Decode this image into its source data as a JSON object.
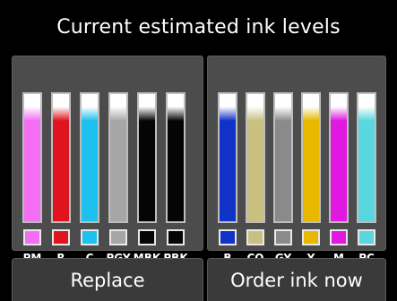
{
  "title": "Current estimated ink levels",
  "buttons": {
    "replace": "Replace",
    "order": "Order ink now"
  },
  "ink_groups": [
    {
      "inks": [
        {
          "label": "PM",
          "color": "#f46ef4",
          "level": 0.9
        },
        {
          "label": "R",
          "color": "#e0141e",
          "level": 0.9
        },
        {
          "label": "C",
          "color": "#1cc1ee",
          "level": 0.9
        },
        {
          "label": "PGY",
          "color": "#a6a6a6",
          "level": 0.9
        },
        {
          "label": "MBK",
          "color": "#050505",
          "level": 0.9
        },
        {
          "label": "PBK",
          "color": "#050505",
          "level": 0.9
        }
      ]
    },
    {
      "inks": [
        {
          "label": "B",
          "color": "#1032c6",
          "level": 0.9
        },
        {
          "label": "CO",
          "color": "#c9c07f",
          "level": 0.9
        },
        {
          "label": "GY",
          "color": "#8a8a8a",
          "level": 0.9
        },
        {
          "label": "Y",
          "color": "#e8b800",
          "level": 0.9
        },
        {
          "label": "M",
          "color": "#e018e0",
          "level": 0.9
        },
        {
          "label": "PC",
          "color": "#5ad6df",
          "level": 0.9
        }
      ]
    }
  ]
}
